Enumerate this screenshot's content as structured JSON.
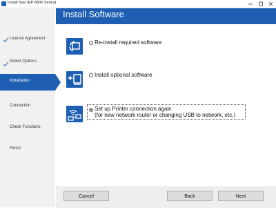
{
  "window": {
    "title": "Install Navi [EP-8806 Series]"
  },
  "header": {
    "title": "Install Software"
  },
  "sidebar": {
    "items": [
      {
        "label": "License Agreement",
        "state": "done"
      },
      {
        "label": "Select Options",
        "state": "done"
      },
      {
        "label": "Installation",
        "state": "active"
      },
      {
        "label": "Connection",
        "state": "pending"
      },
      {
        "label": "Check Functions",
        "state": "pending"
      },
      {
        "label": "Finish",
        "state": "pending"
      }
    ]
  },
  "options": [
    {
      "label": "Re-install required software",
      "selected": false,
      "icon": "reinstall-icon"
    },
    {
      "label": "Install optional software",
      "selected": false,
      "icon": "add-software-icon"
    },
    {
      "label_line1": "Set up Printer connection again",
      "label_line2": "(for new network router or changing USB to network, etc.)",
      "selected": true,
      "icon": "network-connection-icon"
    }
  ],
  "footer": {
    "cancel_label": "Cancel",
    "back_label": "Back",
    "next_label": "Next"
  },
  "colors": {
    "accent": "#1e5fb3",
    "sidebar_bg": "#f1f1f1",
    "check": "#1e5fb3"
  }
}
